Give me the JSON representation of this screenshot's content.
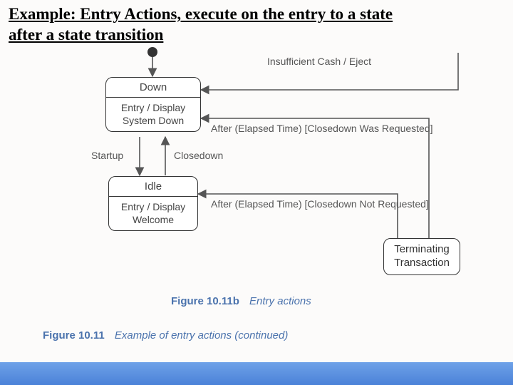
{
  "title_line1": "Example: Entry Actions, execute on the entry to a state",
  "title_line2": " after a state transition",
  "states": {
    "down": {
      "name": "Down",
      "entry": "Entry / Display System Down"
    },
    "idle": {
      "name": "Idle",
      "entry": "Entry / Display Welcome"
    },
    "terminating": {
      "name": "Terminating Transaction"
    }
  },
  "transitions": {
    "startup": "Startup",
    "closedown": "Closedown",
    "insufficient_cash": "Insufficient Cash / Eject",
    "closedown_was_requested": "After (Elapsed Time) [Closedown Was Requested]",
    "closedown_not_requested": "After (Elapsed Time) [Closedown Not Requested]"
  },
  "captions": {
    "fig_b_label": "Figure 10.11b",
    "fig_b_text": "Entry actions",
    "fig_main_label": "Figure 10.11",
    "fig_main_text": "Example of entry actions (continued)"
  }
}
